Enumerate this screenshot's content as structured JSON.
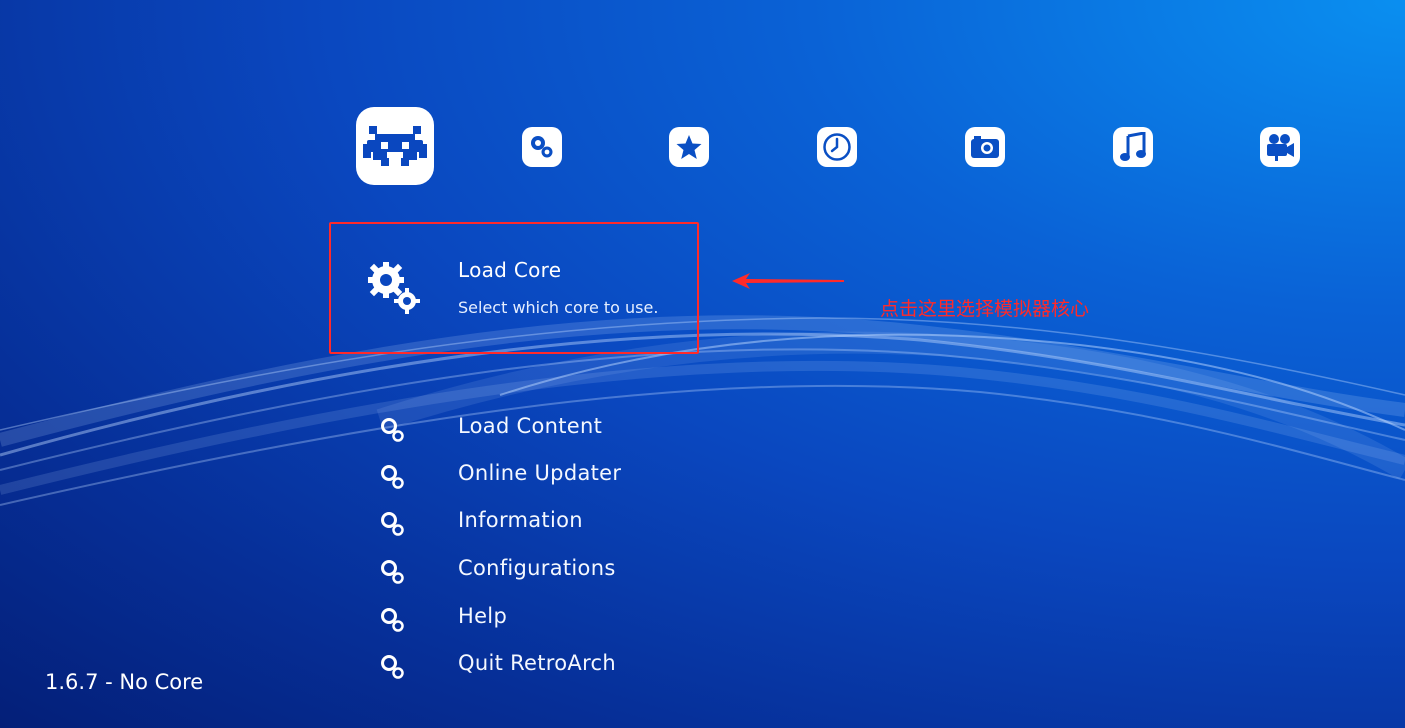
{
  "categories": [
    {
      "icon": "retroarch-invader-icon",
      "selected": true
    },
    {
      "icon": "settings-gears-icon"
    },
    {
      "icon": "favorites-star-icon"
    },
    {
      "icon": "history-clock-icon"
    },
    {
      "icon": "images-camera-icon"
    },
    {
      "icon": "music-note-icon"
    },
    {
      "icon": "video-camera-icon"
    }
  ],
  "selected": {
    "title": "Load Core",
    "subtitle": "Select which core to use.",
    "icon": "gears-icon"
  },
  "annotation": {
    "text": "点击这里选择模拟器核心",
    "color": "#ff2a2a"
  },
  "menu": [
    {
      "label": "Load Content",
      "icon": "gears-icon"
    },
    {
      "label": "Online Updater",
      "icon": "gears-icon"
    },
    {
      "label": "Information",
      "icon": "gears-icon"
    },
    {
      "label": "Configurations",
      "icon": "gears-icon"
    },
    {
      "label": "Help",
      "icon": "gears-icon"
    },
    {
      "label": "Quit RetroArch",
      "icon": "gears-icon"
    }
  ],
  "status": "1.6.7 - No Core",
  "colors": {
    "accent": "#0a62d6",
    "annotation": "#ff2a2a",
    "text": "#ffffff"
  }
}
